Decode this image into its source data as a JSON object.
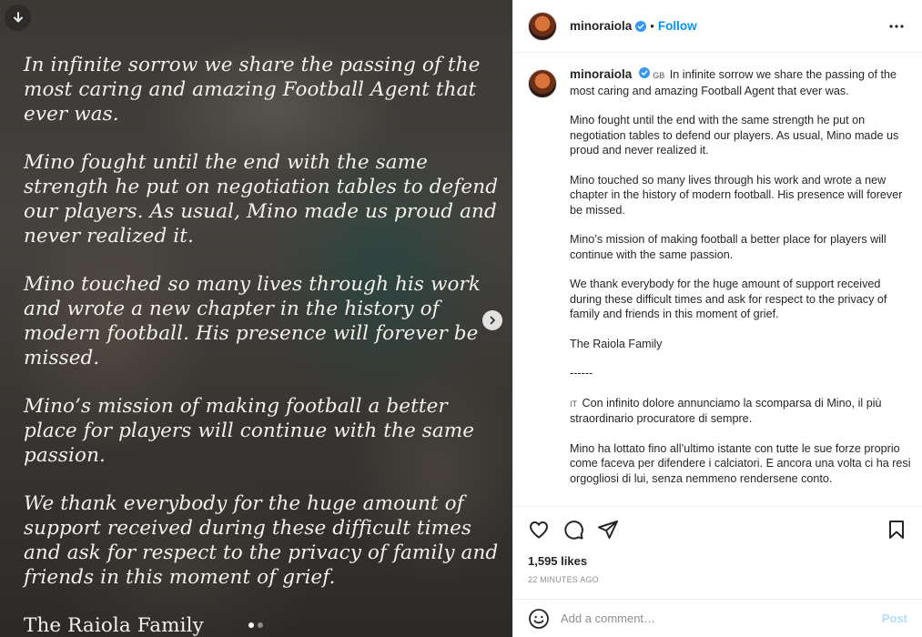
{
  "media": {
    "paragraphs": [
      "In infinite sorrow we share the passing of the most caring and amazing Football Agent that ever was.",
      "Mino fought until the end with the same strength he put on negotiation tables to defend our players. As usual, Mino made us proud and never realized it.",
      "Mino touched so many lives through his work and wrote a new chapter in the history of modern football. His presence will forever be missed.",
      "Mino’s mission of making football a better place for players will continue with the same passion.",
      "We thank everybody for the huge amount of support received during these difficult times and ask for respect to the privacy of family and friends in this moment of grief."
    ],
    "signature": "The Raiola Family",
    "slide_count": 2,
    "current_slide": 1
  },
  "header": {
    "username": "minoraiola",
    "separator": "•",
    "follow_label": "Follow"
  },
  "caption": {
    "username": "minoraiola",
    "flag_gb": "GB",
    "first_line": "In infinite sorrow we share the passing of the most caring and amazing Football Agent that ever was.",
    "paragraphs": [
      "Mino fought until the end with the same strength he put on negotiation tables to defend our players. As usual, Mino made us proud and never realized it.",
      "Mino touched so many lives through his work and wrote a new chapter in the history of modern football. His presence will forever be missed.",
      "Mino’s mission of making football a better place for players will continue with the same passion.",
      "We thank everybody for the huge amount of support received during these difficult times and ask for respect to the privacy of family and friends in this moment of grief.",
      "The Raiola Family",
      "------"
    ],
    "flag_it": "IT",
    "it_first": "Con infinito dolore annunciamo la scomparsa di Mino, il più straordinario procuratore di sempre.",
    "it_paragraphs": [
      "Mino ha lottato fino all’ultimo istante con tutte le sue forze proprio come faceva per difendere i calciatori. E ancora una volta ci ha resi orgogliosi di lui, senza nemmeno rendersene conto."
    ]
  },
  "actions": {
    "likes": "1,595 likes",
    "timestamp": "22 MINUTES AGO"
  },
  "comment": {
    "placeholder": "Add a comment…",
    "post_label": "Post"
  },
  "colors": {
    "accent": "#0095f6",
    "post_disabled": "#b2dffc",
    "verified": "#3897f0"
  },
  "icons": [
    "download-icon",
    "chevron-right-icon",
    "more-icon",
    "verified-icon",
    "heart-icon",
    "comment-icon",
    "share-icon",
    "bookmark-icon",
    "emoji-icon"
  ]
}
